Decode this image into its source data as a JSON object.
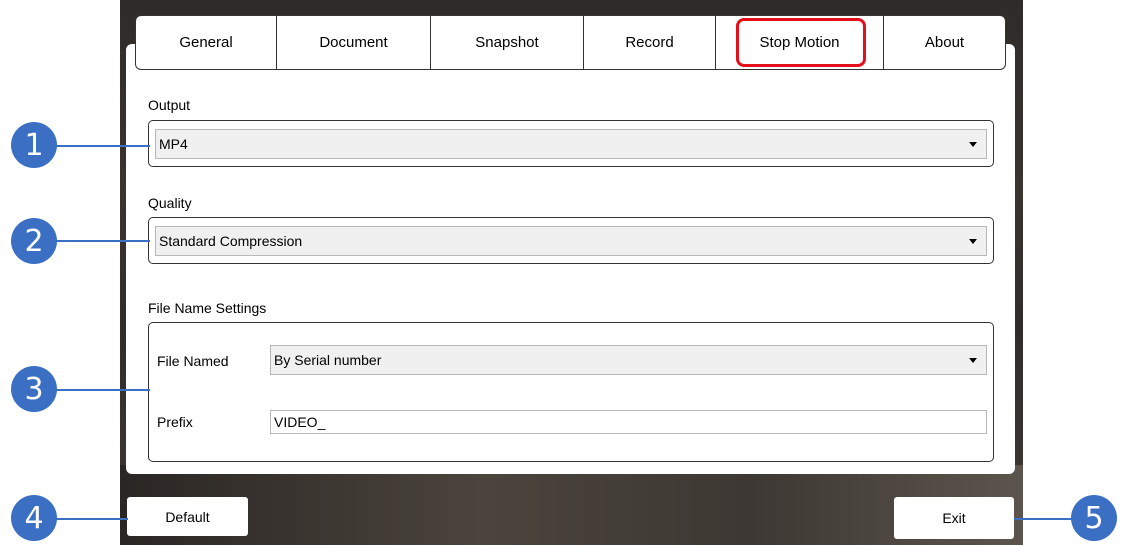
{
  "tabs": [
    {
      "label": "General"
    },
    {
      "label": "Document"
    },
    {
      "label": "Snapshot"
    },
    {
      "label": "Record"
    },
    {
      "label": "Stop Motion",
      "highlighted": true
    },
    {
      "label": "About"
    }
  ],
  "output": {
    "label": "Output",
    "value": "MP4"
  },
  "quality": {
    "label": "Quality",
    "value": "Standard Compression"
  },
  "file_name_settings": {
    "label": "File Name Settings",
    "file_named_label": "File Named",
    "file_named_value": "By Serial number",
    "prefix_label": "Prefix",
    "prefix_value": "VIDEO_"
  },
  "buttons": {
    "default_label": "Default",
    "exit_label": "Exit"
  },
  "callouts": [
    "1",
    "2",
    "3",
    "4",
    "5"
  ],
  "colors": {
    "callout": "#3a6fc4",
    "highlight": "#e3101b"
  }
}
